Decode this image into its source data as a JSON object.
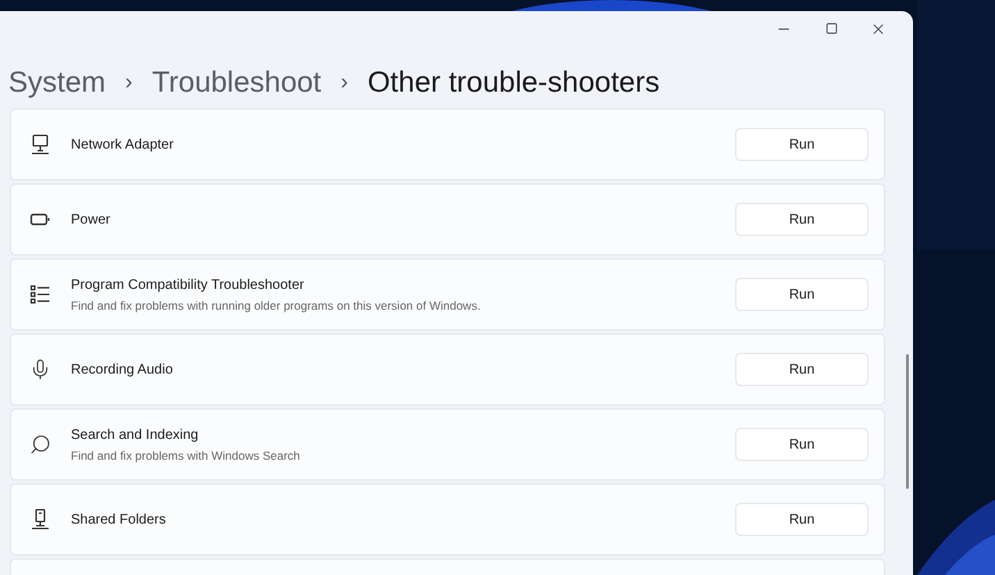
{
  "breadcrumb": [
    {
      "label": "System",
      "current": false
    },
    {
      "label": "›",
      "kind": "separator"
    },
    {
      "label": "Troubleshoot",
      "current": false
    },
    {
      "label": "›",
      "kind": "separator"
    },
    {
      "label": "Other trouble-shooters",
      "current": true
    }
  ],
  "troubleshooters": [
    {
      "title": "Network Adapter",
      "button": "Run"
    },
    {
      "title": "Power",
      "button": "Run"
    },
    {
      "title": "Program Compatibility Troubleshooter",
      "description": "Find and fix problems with running older programs on this version of Windows.",
      "button": "Run"
    },
    {
      "title": "Recording Audio",
      "button": "Run"
    },
    {
      "title": "Search and Indexing",
      "description": "Find and fix problems with Windows Search",
      "button": "Run"
    },
    {
      "title": "Shared Folders",
      "button": "Run"
    }
  ]
}
